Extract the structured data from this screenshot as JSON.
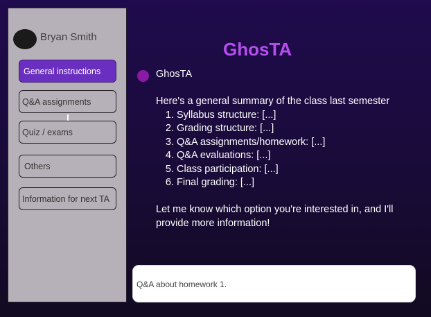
{
  "user": {
    "name": "Bryan Smith"
  },
  "sidebar": {
    "items": [
      {
        "label": "General instructions",
        "active": true
      },
      {
        "label": "Q&A assignments",
        "active": false
      },
      {
        "label": "Quiz / exams",
        "active": false
      },
      {
        "label": "Others",
        "active": false
      },
      {
        "label": "Information for next TA",
        "active": false
      }
    ]
  },
  "header": {
    "title": "GhosTA"
  },
  "chat": {
    "sender": "GhosTA",
    "intro": "Here's a general summary of the class last semester",
    "list": [
      "Syllabus structure: [...]",
      "Grading structure: [...]",
      "Q&A assignments/homework: [...]",
      "Q&A evaluations: [...]",
      "Class participation: [...]",
      "Final grading: [...]"
    ],
    "outro": "Let me know which option you're interested in, and I'll provide more information!"
  },
  "input": {
    "value": "Q&A about homework 1."
  },
  "colors": {
    "accent": "#6a2fc0",
    "title": "#b74df0",
    "bot_dot": "#8a1aa3",
    "sidebar_bg": "#b6b1b8"
  }
}
